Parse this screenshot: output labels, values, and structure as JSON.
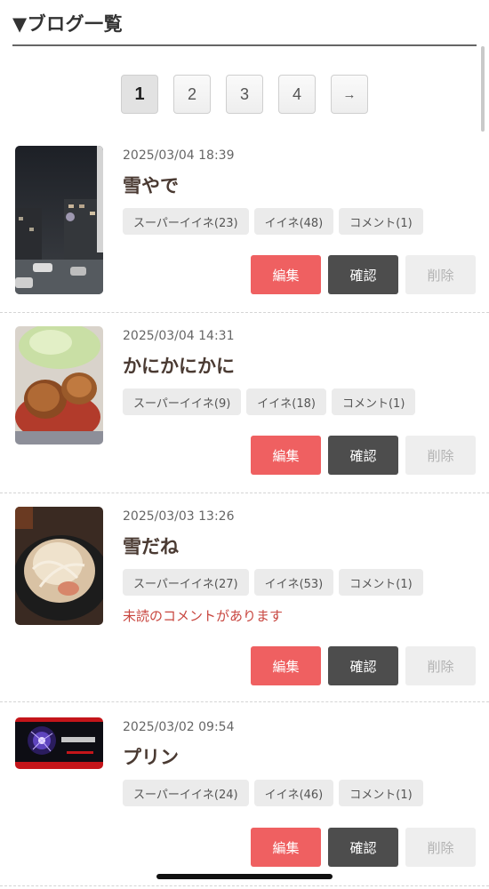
{
  "header": {
    "title": "▼ブログ一覧"
  },
  "pagination": {
    "pages": [
      "1",
      "2",
      "3",
      "4"
    ],
    "next_label": "→",
    "current": "1"
  },
  "posts": [
    {
      "date": "2025/03/04 18:39",
      "title": "雪やで",
      "tags": [
        "スーパーイイネ(23)",
        "イイネ(48)",
        "コメント(1)"
      ],
      "alert": "",
      "edit_label": "編集",
      "view_label": "確認",
      "delete_label": "削除"
    },
    {
      "date": "2025/03/04 14:31",
      "title": "かにかにかに",
      "tags": [
        "スーパーイイネ(9)",
        "イイネ(18)",
        "コメント(1)"
      ],
      "alert": "",
      "edit_label": "編集",
      "view_label": "確認",
      "delete_label": "削除"
    },
    {
      "date": "2025/03/03 13:26",
      "title": "雪だね",
      "tags": [
        "スーパーイイネ(27)",
        "イイネ(53)",
        "コメント(1)"
      ],
      "alert": "未読のコメントがあります",
      "edit_label": "編集",
      "view_label": "確認",
      "delete_label": "削除"
    },
    {
      "date": "2025/03/02 09:54",
      "title": "プリン",
      "tags": [
        "スーパーイイネ(24)",
        "イイネ(46)",
        "コメント(1)"
      ],
      "alert": "",
      "edit_label": "編集",
      "view_label": "確認",
      "delete_label": "削除"
    }
  ],
  "colors": {
    "edit_button": "#ef6061",
    "view_button": "#4d4d4d",
    "delete_button": "#eeeeee",
    "alert_text": "#c8463f",
    "title_text": "#4a3a32"
  }
}
